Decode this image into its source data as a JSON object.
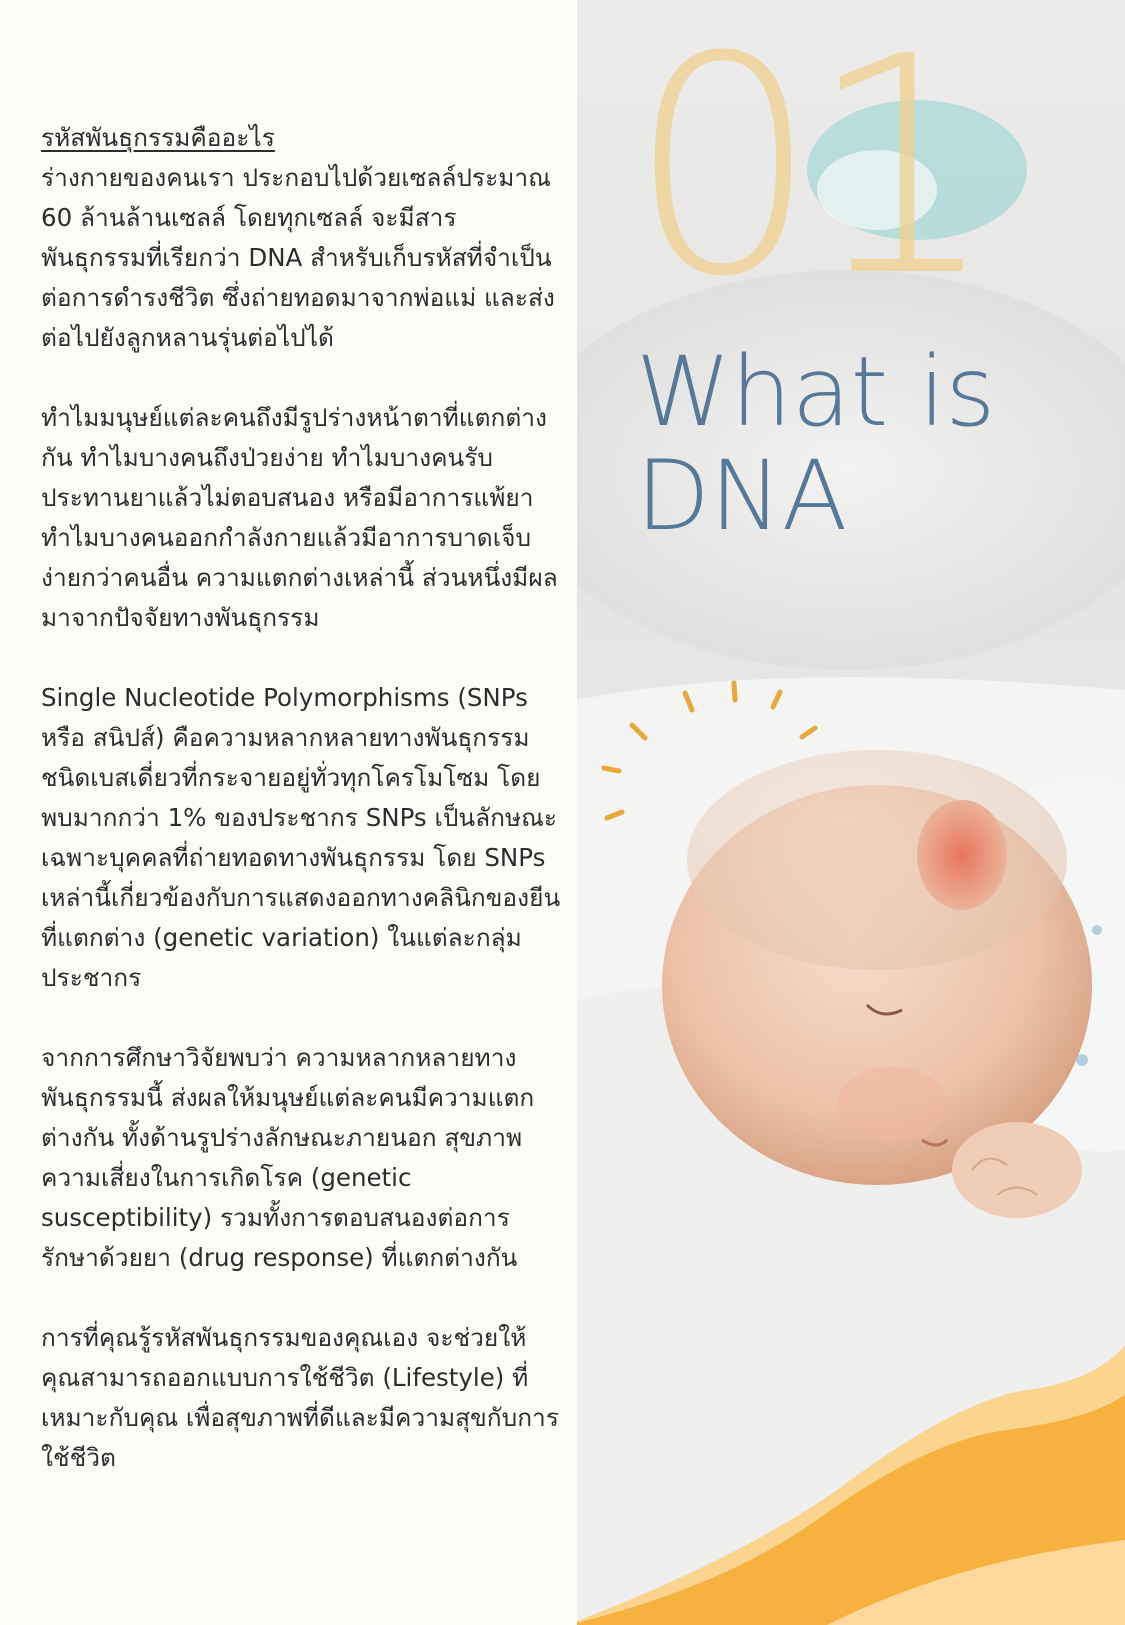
{
  "header": {
    "number": "01",
    "title_line1": "What is",
    "title_line2": "DNA"
  },
  "article": {
    "heading": "รหัสพันธุกรรมคืออะไร",
    "paragraphs": [
      "ร่างกายของคนเรา ประกอบไปด้วยเซลล์ประมาณ 60 ล้านล้านเซลล์ โดยทุกเซลล์ จะมีสารพันธุกรรมที่เรียกว่า DNA สำหรับเก็บรหัสที่จำเป็นต่อการดำรงชีวิต ซึ่งถ่ายทอดมาจากพ่อแม่ และส่งต่อไปยังลูกหลานรุ่นต่อไปได้",
      "ทำไมมนุษย์แต่ละคนถึงมีรูปร่างหน้าตาที่แตกต่างกัน ทำไมบางคนถึงป่วยง่าย ทำไมบางคนรับประทานยาแล้วไม่ตอบสนอง หรือมีอาการแพ้ยา ทำไมบางคนออกกำลังกายแล้วมีอาการบาดเจ็บง่ายกว่าคนอื่น ความแตกต่างเหล่านี้ ส่วนหนึ่งมีผลมาจากปัจจัยทางพันธุกรรม",
      "Single Nucleotide Polymorphisms (SNPs หรือ สนิปส์) คือความหลากหลายทางพันธุกรรมชนิดเบสเดี่ยวที่กระจายอยู่ทั่วทุกโครโมโซม โดยพบมากกว่า 1% ของประชากร SNPs เป็นลักษณะเฉพาะบุคคลที่ถ่ายทอดทางพันธุกรรม โดย SNPs เหล่านี้เกี่ยวข้องกับการแสดงออกทางคลินิกของยีนที่แตกต่าง (genetic variation) ในแต่ละกลุ่มประชากร",
      "จากการศึกษาวิจัยพบว่า ความหลากหลายทางพันธุกรรมนี้ ส่งผลให้มนุษย์แต่ละคนมีความแตกต่างกัน ทั้งด้านรูปร่างลักษณะภายนอก สุขภาพ ความเสี่ยงในการเกิดโรค (genetic susceptibility) รวมทั้งการตอบสนองต่อการรักษาด้วยยา (drug response) ที่แตกต่างกัน",
      "การที่คุณรู้รหัสพันธุกรรมของคุณเอง จะช่วยให้คุณสามารถออกแบบการใช้ชีวิต (Lifestyle) ที่เหมาะกับคุณ เพื่อสุขภาพที่ดีและมีความสุขกับการใช้ชีวิต"
    ]
  },
  "colors": {
    "title": "#56799a",
    "number": "#f0d08e",
    "accent_wave": "#f7b03d",
    "accent_wave_light": "#fcd596",
    "text": "#2d2d2d"
  },
  "image": {
    "subject": "sleeping-baby-photo"
  }
}
